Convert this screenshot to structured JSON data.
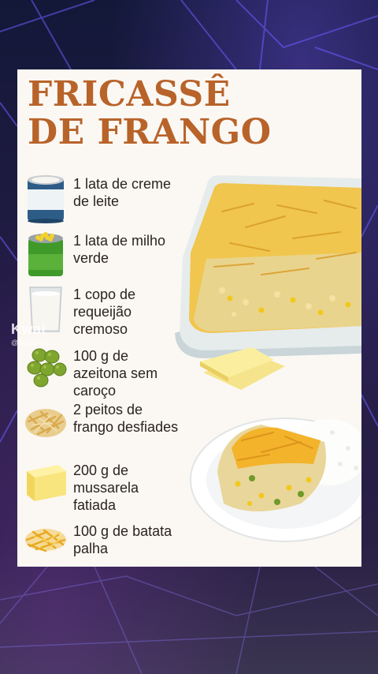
{
  "title": {
    "line1": "FRICASSÊ",
    "line2": "DE FRANGO"
  },
  "ingredients": [
    {
      "text": "1 lata de creme de leite",
      "icon": "cream-can-icon"
    },
    {
      "text": "1 lata de milho verde",
      "icon": "corn-can-icon"
    },
    {
      "text": "1 copo de requeijão cremoso",
      "icon": "cream-cheese-glass-icon"
    },
    {
      "text": "100 g de azeitona sem caroço",
      "icon": "olives-icon"
    },
    {
      "text": "2 peitos de frango desfiades",
      "icon": "shredded-chicken-icon"
    },
    {
      "text": "200 g de mussarela fatiada",
      "icon": "mozzarella-block-icon"
    },
    {
      "text": "100 g de batata palha",
      "icon": "potato-sticks-icon"
    }
  ],
  "watermark": {
    "app": "Kwai",
    "handle": "@acacertei..."
  },
  "colors": {
    "title": "#b8632a",
    "card": "#fbf8f3",
    "background": "#151a3a"
  }
}
